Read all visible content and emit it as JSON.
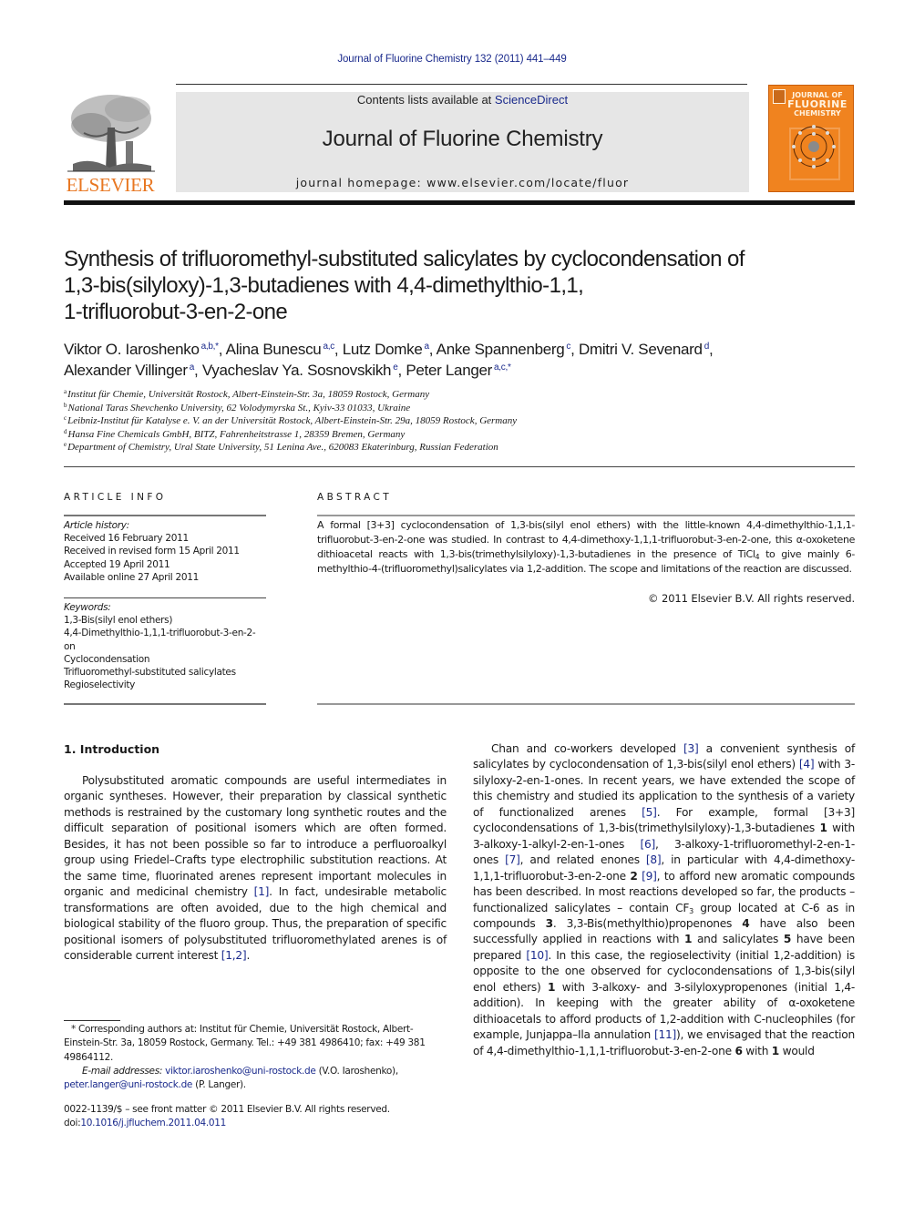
{
  "citation": "Journal of Fluorine Chemistry 132 (2011) 441–449",
  "header": {
    "publisher_wordmark": "ELSEVIER",
    "contents_prefix": "Contents lists available at ",
    "contents_link": "ScienceDirect",
    "journal_name": "Journal of Fluorine Chemistry",
    "homepage_prefix": "journal homepage: ",
    "homepage_url": "www.elsevier.com/locate/fluor",
    "cover": {
      "line1": "JOURNAL OF",
      "line2": "FLUORINE",
      "line3": "CHEMISTRY",
      "accent_color": "#f0831f"
    }
  },
  "article": {
    "title_lines": [
      "Synthesis of trifluoromethyl-substituted salicylates by cyclocondensation of",
      "1,3-bis(silyloxy)-1,3-butadienes with 4,4-dimethylthio-1,1,",
      "1-trifluorobut-3-en-2-one"
    ],
    "authors": [
      {
        "name": "Viktor O. Iaroshenko",
        "sup": "a,b,*",
        "sep": ", "
      },
      {
        "name": "Alina Bunescu",
        "sup": "a,c",
        "sep": ", "
      },
      {
        "name": "Lutz Domke",
        "sup": "a",
        "sep": ", "
      },
      {
        "name": "Anke Spannenberg",
        "sup": "c",
        "sep": ", "
      },
      {
        "name": "Dmitri V. Sevenard",
        "sup": "d",
        "sep": ","
      },
      {
        "name": "Alexander Villinger",
        "sup": "a",
        "sep": ", "
      },
      {
        "name": "Vyacheslav Ya. Sosnovskikh",
        "sup": "e",
        "sep": ", "
      },
      {
        "name": "Peter Langer",
        "sup": "a,c,*",
        "sep": ""
      }
    ],
    "affiliations": [
      {
        "key": "a",
        "text": "Institut für Chemie, Universität Rostock, Albert-Einstein-Str. 3a, 18059 Rostock, Germany"
      },
      {
        "key": "b",
        "text": "National Taras Shevchenko University, 62 Volodymyrska St., Kyiv-33 01033, Ukraine"
      },
      {
        "key": "c",
        "text": "Leibniz-Institut für Katalyse e. V. an der Universität Rostock, Albert-Einstein-Str. 29a, 18059 Rostock, Germany"
      },
      {
        "key": "d",
        "text": "Hansa Fine Chemicals GmbH, BITZ, Fahrenheitstrasse 1, 28359 Bremen, Germany"
      },
      {
        "key": "e",
        "text": "Department of Chemistry, Ural State University, 51 Lenina Ave., 620083 Ekaterinburg, Russian Federation"
      }
    ]
  },
  "article_info": {
    "label": "ARTICLE INFO",
    "history_heading": "Article history:",
    "history": [
      "Received 16 February 2011",
      "Received in revised form 15 April 2011",
      "Accepted 19 April 2011",
      "Available online 27 April 2011"
    ],
    "keywords_heading": "Keywords:",
    "keywords": [
      "1,3-Bis(silyl enol ethers)",
      "4,4-Dimethylthio-1,1,1-trifluorobut-3-en-2-on",
      "Cyclocondensation",
      "Trifluoromethyl-substituted salicylates",
      "Regioselectivity"
    ]
  },
  "abstract": {
    "label": "ABSTRACT",
    "p1": "A formal [3+3] cyclocondensation of 1,3-bis(silyl enol ethers) with the little-known 4,4-dimethylthio-1,1,1-trifluorobut-3-en-2-one was studied. In contrast to 4,4-dimethoxy-1,1,1-trifluorobut-3-en-2-one, this α-oxoketene dithioacetal reacts with 1,3-bis(trimethylsilyloxy)-1,3-butadienes in the presence of TiCl",
    "p1_sub": "4",
    "p2": " to give mainly 6-methylthio-4-(trifluoromethyl)salicylates via 1,2-addition. The scope and limitations of the reaction are discussed.",
    "copyright": "© 2011 Elsevier B.V. All rights reserved."
  },
  "intro": {
    "heading": "1.  Introduction",
    "left": {
      "t1": "Polysubstituted aromatic compounds are useful intermediates in organic syntheses. However, their preparation by classical synthetic methods is restrained by the customary long synthetic routes and the difficult separation of positional isomers which are often formed. Besides, it has not been possible so far to introduce a perfluoroalkyl group using Friedel–Crafts type electrophilic substitution reactions. At the same time, fluorinated arenes represent important molecules in organic and medicinal chemistry ",
      "r1": "[1]",
      "t2": ". In fact, undesirable metabolic transformations are often avoided, due to the high chemical and biological stability of the fluoro group. Thus, the preparation of specific positional isomers of polysubstituted trifluoromethylated arenes is of considerable current interest ",
      "r2": "[1,2]",
      "t3": "."
    },
    "right": {
      "t1": "Chan and co-workers developed ",
      "r3": "[3]",
      "t2": " a convenient synthesis of salicylates by cyclocondensation of 1,3-bis(silyl enol ethers) ",
      "r4": "[4]",
      "t3": " with 3-silyloxy-2-en-1-ones. In recent years, we have extended the scope of this chemistry and studied its application to the synthesis of a variety of functionalized arenes ",
      "r5": "[5]",
      "t4": ". For example, formal [3+3] cyclocondensations of 1,3-bis(trimethylsilyloxy)-1,3-butadienes ",
      "c1": "1",
      "t5": " with 3-alkoxy-1-alkyl-2-en-1-ones ",
      "r6": "[6]",
      "t6": ", 3-alkoxy-1-trifluoromethyl-2-en-1-ones ",
      "r7": "[7]",
      "t7": ", and related enones ",
      "r8": "[8]",
      "t8": ", in particular with 4,4-dimethoxy-1,1,1-trifluorobut-3-en-2-one ",
      "c2": "2",
      "t9": " ",
      "r9": "[9]",
      "t10": ", to afford new aromatic compounds has been described. In most reactions developed so far, the products – functionalized salicylates – contain CF",
      "sub3": "3",
      "t11": " group located at C-6 as in compounds ",
      "c3": "3",
      "t12": ". 3,3-Bis(methylthio)propenones ",
      "c4": "4",
      "t13": " have also been successfully applied in reactions with ",
      "c1b": "1",
      "t14": " and salicylates ",
      "c5": "5",
      "t15": " have been prepared ",
      "r10": "[10]",
      "t16": ". In this case, the regioselectivity (initial 1,2-addition) is opposite to the one observed for cyclocondensations of 1,3-bis(silyl enol ethers) ",
      "c1c": "1",
      "t17": " with 3-alkoxy- and 3-silyloxypropenones (initial 1,4-addition). In keeping with the greater ability of α-oxoketene dithioacetals to afford products of 1,2-addition with C-nucleophiles (for example, Junjappa–Ila annulation ",
      "r11": "[11]",
      "t18": "), we envisaged that the reaction of 4,4-dimethylthio-1,1,1-trifluorobut-3-en-2-one ",
      "c6": "6",
      "t19": " with ",
      "c1d": "1",
      "t20": " would"
    }
  },
  "footnotes": {
    "corresponding": "* Corresponding authors at: Institut für Chemie, Universität Rostock, Albert-Einstein-Str. 3a, 18059 Rostock, Germany. Tel.: +49 381 4986410; fax: +49 381 49864112.",
    "email_label": "E-mail addresses: ",
    "email1": "viktor.iaroshenko@uni-rostock.de",
    "email1_owner": " (V.O. Iaroshenko),",
    "email2": "peter.langer@uni-rostock.de",
    "email2_owner": " (P. Langer)."
  },
  "front_matter": {
    "issn_line": "0022-1139/$ – see front matter © 2011 Elsevier B.V. All rights reserved.",
    "doi_prefix": "doi:",
    "doi": "10.1016/j.jfluchem.2011.04.011"
  }
}
